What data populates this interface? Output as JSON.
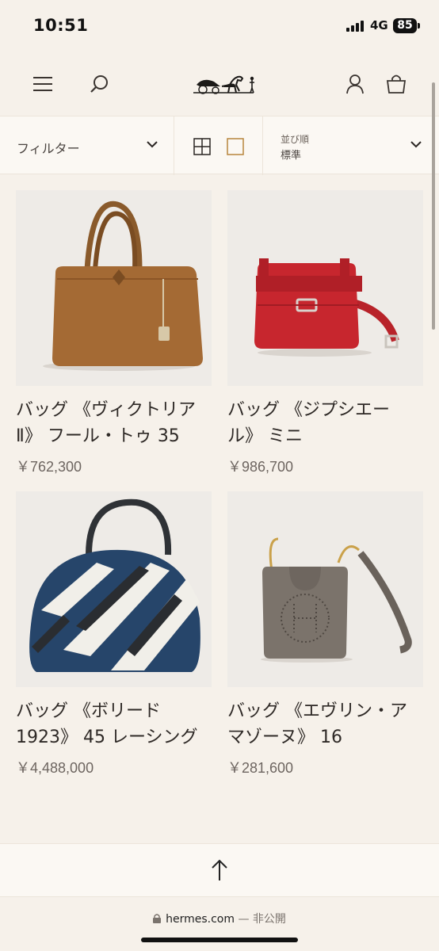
{
  "status_bar": {
    "time": "10:51",
    "network": "4G",
    "battery": "85"
  },
  "header": {
    "menu_icon": "menu-icon",
    "search_icon": "search-icon",
    "logo_icon": "carriage-logo-icon",
    "account_icon": "account-icon",
    "bag_icon": "shopping-bag-icon"
  },
  "filter_bar": {
    "filter_label": "フィルター",
    "view_grid_icon": "grid-view-icon",
    "view_single_icon": "single-view-icon",
    "sort_label": "並び順",
    "sort_value": "標準"
  },
  "products": [
    {
      "name": "バッグ 《ヴィクトリア Ⅱ》 フール・トゥ 35",
      "price": "￥762,300",
      "image_icon": "brown-bag-image"
    },
    {
      "name": "バッグ 《ジプシエール》 ミニ",
      "price": "￥986,700",
      "image_icon": "red-bag-image"
    },
    {
      "name": "バッグ 《ボリード 1923》 45 レーシング",
      "price": "￥4,488,000",
      "image_icon": "racing-bag-image"
    },
    {
      "name": "バッグ 《エヴリン・アマゾーヌ》 16",
      "price": "￥281,600",
      "image_icon": "grey-bag-image"
    }
  ],
  "back_to_top_icon": "arrow-up-icon",
  "url_bar": {
    "domain": "hermes.com",
    "suffix": "— 非公開",
    "lock_icon": "lock-icon"
  },
  "colors": {
    "background": "#f6f1ea",
    "bar": "#fbf8f3",
    "text": "#2a2522",
    "price": "#6d6560"
  }
}
